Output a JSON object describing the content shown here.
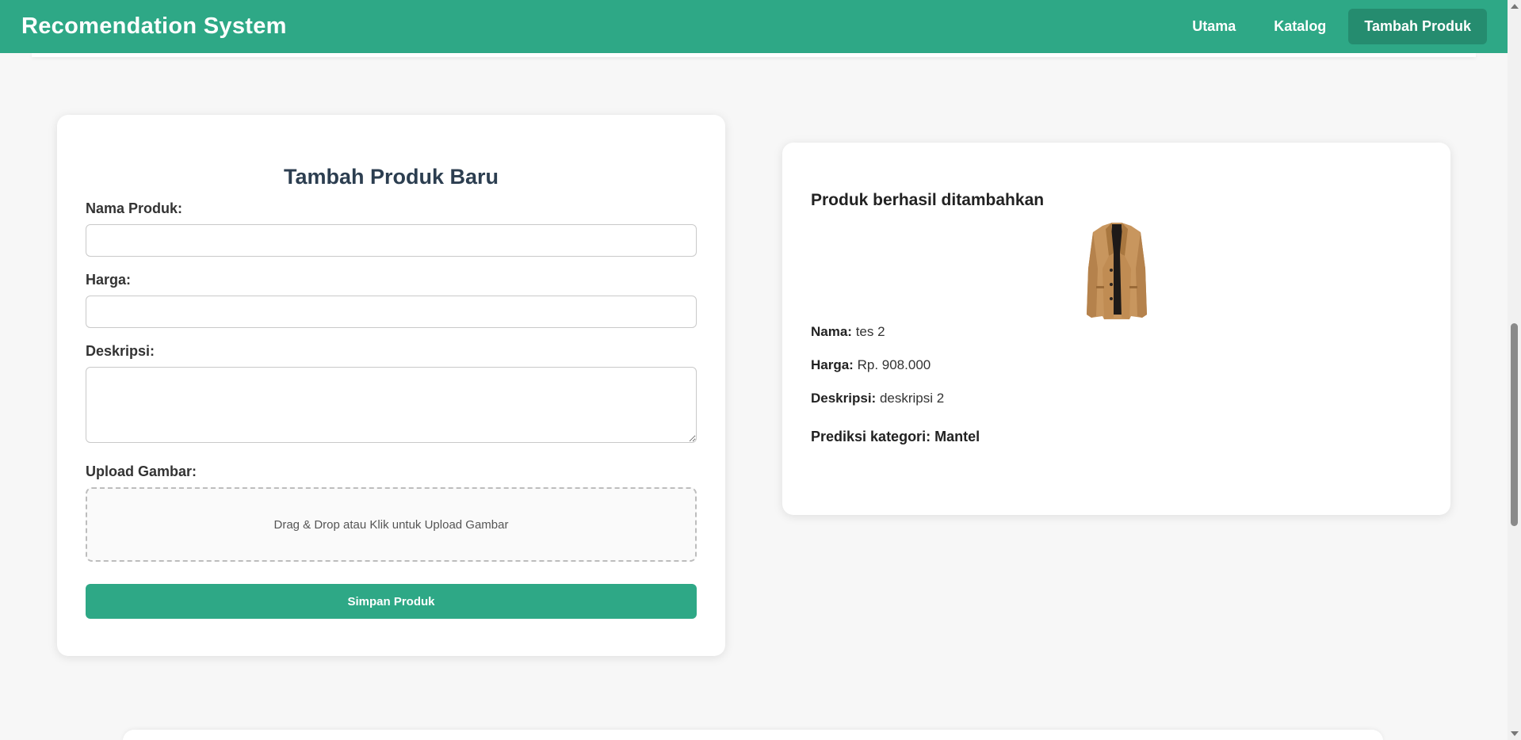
{
  "navbar": {
    "brand": "Recomendation System",
    "links": [
      {
        "label": "Utama"
      },
      {
        "label": "Katalog"
      },
      {
        "label": "Tambah Produk"
      }
    ],
    "accent_color": "#2ea886"
  },
  "form": {
    "title": "Tambah Produk Baru",
    "name_label": "Nama Produk:",
    "name_value": "",
    "price_label": "Harga:",
    "price_value": "",
    "desc_label": "Deskripsi:",
    "desc_value": "",
    "upload_label": "Upload Gambar:",
    "upload_text": "Drag & Drop atau Klik untuk Upload Gambar",
    "submit_label": "Simpan Produk"
  },
  "result": {
    "title": "Produk berhasil ditambahkan",
    "image_icon": "coat-image",
    "name_key": "Nama:",
    "name_value": "tes 2",
    "price_key": "Harga:",
    "price_value": "Rp. 908.000",
    "desc_key": "Deskripsi:",
    "desc_value": "deskripsi 2",
    "prediction_key": "Prediksi kategori:",
    "prediction_value": "Mantel"
  }
}
